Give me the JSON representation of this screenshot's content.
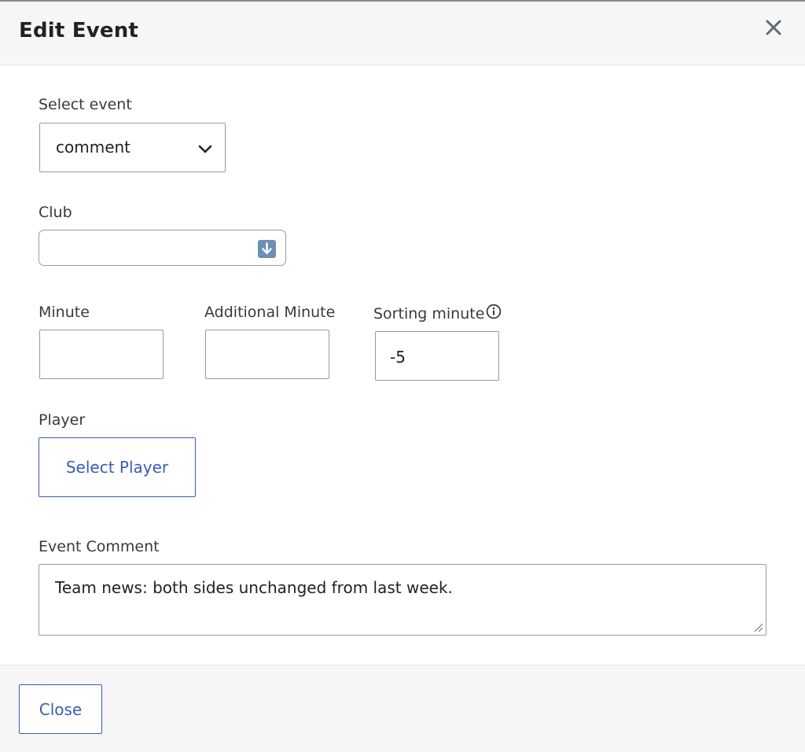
{
  "modal": {
    "title": "Edit Event",
    "close_icon": "close-icon"
  },
  "form": {
    "select_event": {
      "label": "Select event",
      "value": "comment",
      "icon": "chevron-down-icon"
    },
    "club": {
      "label": "Club",
      "value": "",
      "icon": "down-arrow-icon"
    },
    "minute": {
      "label": "Minute",
      "value": ""
    },
    "additional_minute": {
      "label": "Additional Minute",
      "value": ""
    },
    "sorting_minute": {
      "label": "Sorting minute",
      "value": "-5",
      "icon": "info-icon"
    },
    "player": {
      "label": "Player",
      "button_label": "Select Player"
    },
    "event_comment": {
      "label": "Event Comment",
      "value": "Team news: both sides unchanged from last week."
    }
  },
  "footer": {
    "close_label": "Close"
  },
  "colors": {
    "accent": "#3a5bb8",
    "border": "#9a9a9a",
    "header_bg": "#f6f6f6"
  }
}
